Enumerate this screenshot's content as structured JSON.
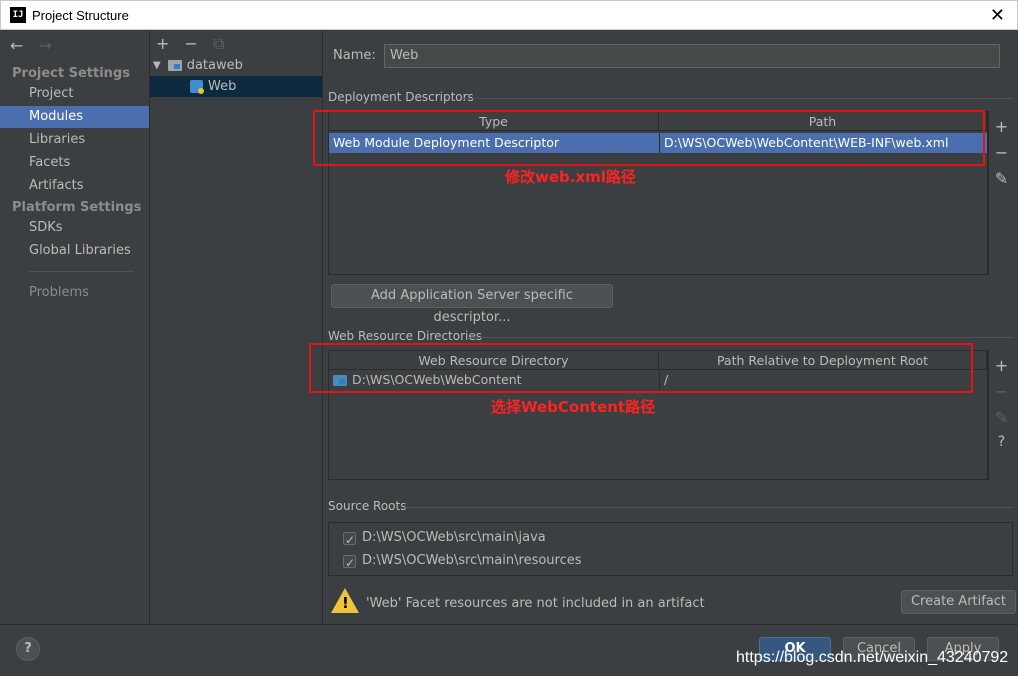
{
  "window": {
    "title": "Project Structure",
    "app_icon_text": "IJ",
    "close_glyph": "✕"
  },
  "nav": {
    "back": "←",
    "forward": "→"
  },
  "sidebar": {
    "project_settings_header": "Project Settings",
    "platform_settings_header": "Platform Settings",
    "items": [
      {
        "label": "Project"
      },
      {
        "label": "Modules"
      },
      {
        "label": "Libraries"
      },
      {
        "label": "Facets"
      },
      {
        "label": "Artifacts"
      },
      {
        "label": "SDKs"
      },
      {
        "label": "Global Libraries"
      },
      {
        "label": "Problems"
      }
    ]
  },
  "tree": {
    "add": "+",
    "remove": "−",
    "copy": "⧉",
    "expander": "▼",
    "root": "dataweb",
    "child": "Web"
  },
  "main": {
    "name_label": "Name:",
    "name_value": "Web",
    "deployment": {
      "group_label": "Deployment Descriptors",
      "headers": [
        "Type",
        "Path"
      ],
      "row": {
        "type": "Web Module Deployment Descriptor",
        "path": "D:\\WS\\OCWeb\\WebContent\\WEB-INF\\web.xml"
      },
      "add_button": "Add Application Server specific descriptor..."
    },
    "resources": {
      "group_label": "Web Resource Directories",
      "headers": [
        "Web Resource Directory",
        "Path Relative to Deployment Root"
      ],
      "row": {
        "directory": "D:\\WS\\OCWeb\\WebContent",
        "relative": "/"
      }
    },
    "source_roots": {
      "group_label": "Source Roots",
      "items": [
        "D:\\WS\\OCWeb\\src\\main\\java",
        "D:\\WS\\OCWeb\\src\\main\\resources"
      ]
    },
    "warning_text": "'Web' Facet resources are not included in an artifact",
    "create_artifact": "Create Artifact"
  },
  "tools": {
    "plus": "+",
    "minus": "−",
    "edit": "✎",
    "help": "?"
  },
  "annotations": {
    "first": "修改web.xml路径",
    "second": "选择WebContent路径"
  },
  "footer": {
    "ok": "OK",
    "cancel": "Cancel",
    "apply": "Apply",
    "help": "?",
    "watermark": "https://blog.csdn.net/weixin_43240792"
  }
}
